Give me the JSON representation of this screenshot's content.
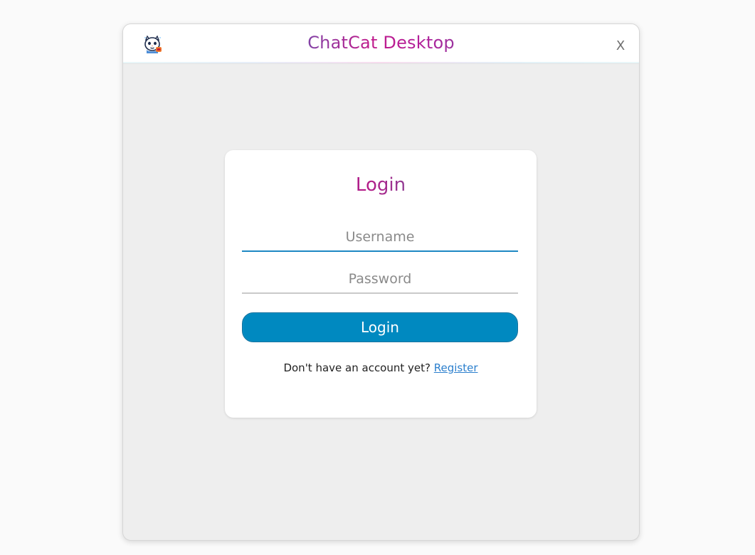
{
  "app": {
    "title": "ChatCat Desktop",
    "close_label": "X",
    "logo_icon": "chatcat-logo-icon"
  },
  "login": {
    "title": "Login",
    "username_placeholder": "Username",
    "password_placeholder": "Password",
    "button_label": "Login",
    "account_prompt": "Don't have an account yet?",
    "register_label": "Register"
  },
  "colors": {
    "window_background": "#eeeeee",
    "titlebar_background": "#ffffff",
    "accent_blue": "#0089c0",
    "link_blue": "#2b7fcd",
    "title_magenta": "#b61b88",
    "title_teal": "#1aa6b7"
  }
}
